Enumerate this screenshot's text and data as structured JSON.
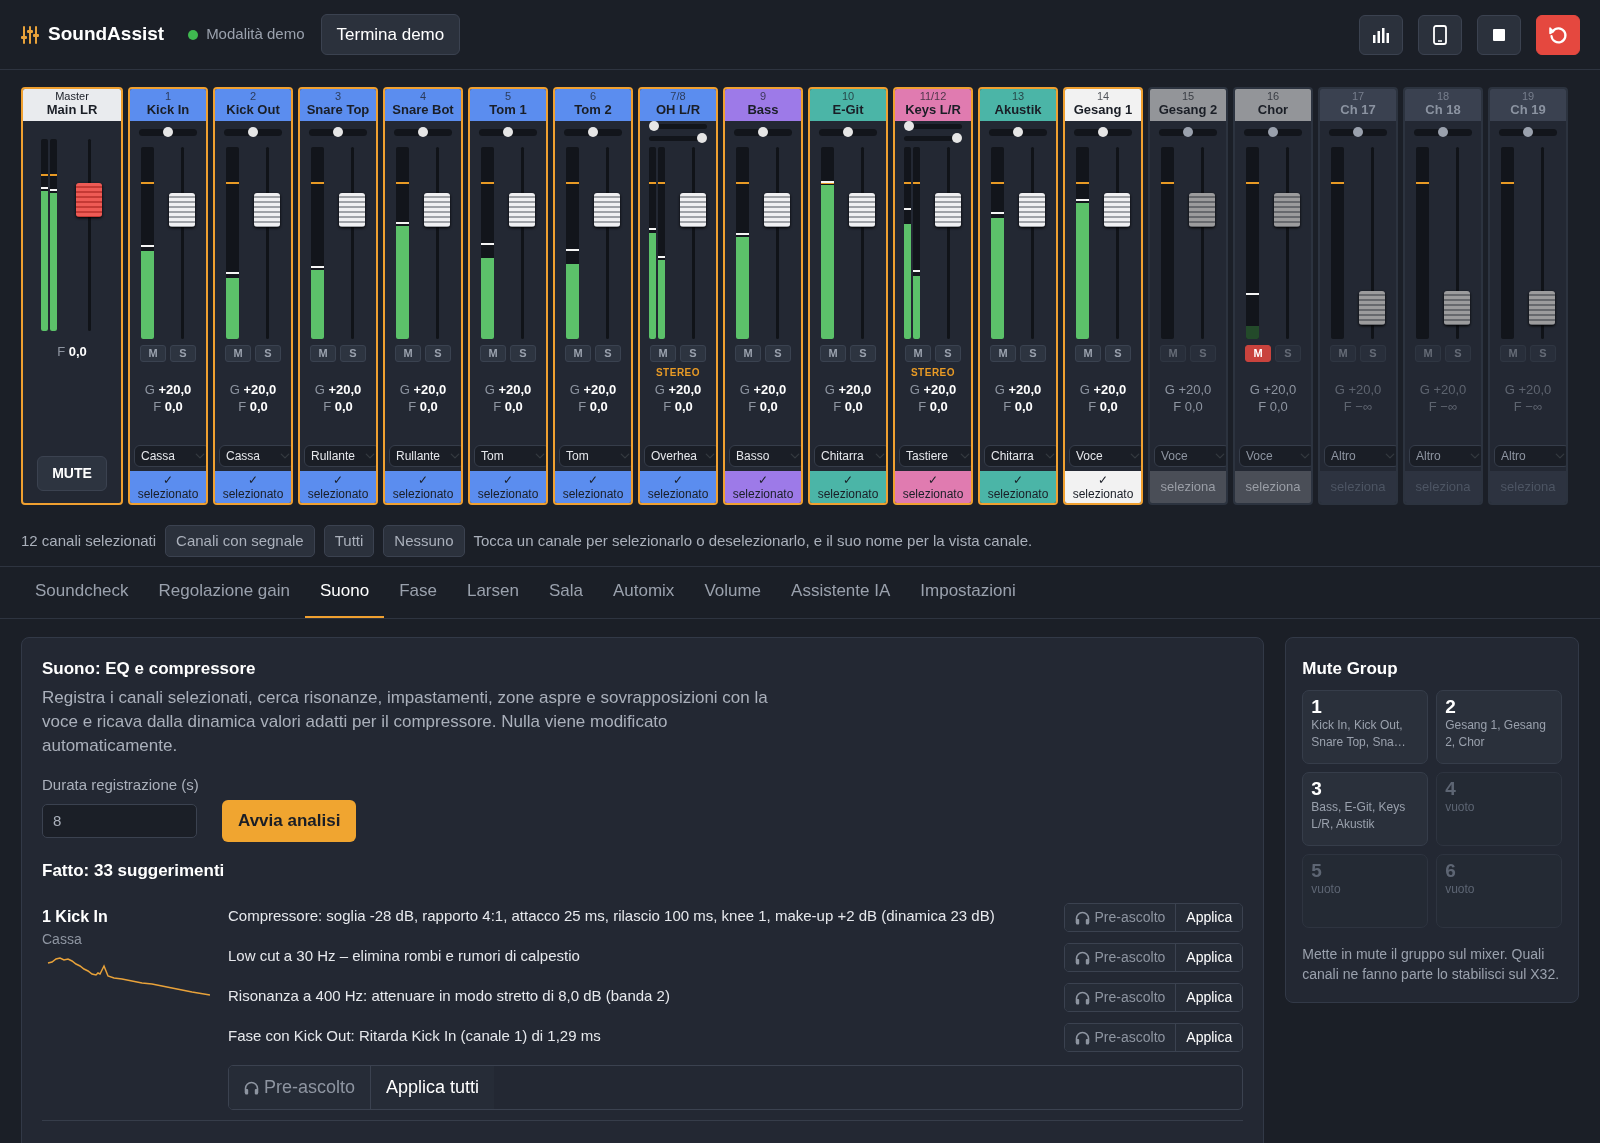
{
  "app": {
    "brand": "SoundAssist",
    "mode": {
      "label": "Modalità demo",
      "active": true
    },
    "end_demo": "Termina demo"
  },
  "master": {
    "kicker": "Master",
    "name": "Main LR",
    "meters": [
      {
        "level": 0.73,
        "peak": {
          "level": 0.74
        }
      },
      {
        "level": 0.72,
        "peak": {
          "level": 0.73
        }
      }
    ],
    "fader": {
      "label": "F",
      "value": "0,0",
      "level": 0.72
    },
    "mute_button": "MUTE"
  },
  "channels": [
    {
      "number": "1",
      "name": "Kick In",
      "color": "#5b8def",
      "selected": true,
      "pan": [
        {
          "level": 0.5
        }
      ],
      "meters": [
        {
          "level": 0.46,
          "peak": {
            "level": 0.48
          }
        }
      ],
      "mute": {
        "label": "M",
        "on": false
      },
      "solo": {
        "label": "S",
        "on": false
      },
      "gain": {
        "label": "G",
        "value": "+20,0"
      },
      "fader": {
        "label": "F",
        "value": "0,0",
        "level": 0.71
      },
      "preset": "Cassa",
      "footer": {
        "mark": "✓",
        "label": "selezionato"
      }
    },
    {
      "number": "2",
      "name": "Kick Out",
      "color": "#5b8def",
      "selected": true,
      "pan": [
        {
          "level": 0.5
        }
      ],
      "meters": [
        {
          "level": 0.32,
          "peak": {
            "level": 0.34
          }
        }
      ],
      "mute": {
        "label": "M",
        "on": false
      },
      "solo": {
        "label": "S",
        "on": false
      },
      "gain": {
        "label": "G",
        "value": "+20,0"
      },
      "fader": {
        "label": "F",
        "value": "0,0",
        "level": 0.71
      },
      "preset": "Cassa",
      "footer": {
        "mark": "✓",
        "label": "selezionato"
      }
    },
    {
      "number": "3",
      "name": "Snare Top",
      "color": "#5b8def",
      "selected": true,
      "pan": [
        {
          "level": 0.5
        }
      ],
      "meters": [
        {
          "level": 0.36,
          "peak": {
            "level": 0.37
          }
        }
      ],
      "mute": {
        "label": "M",
        "on": false
      },
      "solo": {
        "label": "S",
        "on": false
      },
      "gain": {
        "label": "G",
        "value": "+20,0"
      },
      "fader": {
        "label": "F",
        "value": "0,0",
        "level": 0.71
      },
      "preset": "Rullante",
      "footer": {
        "mark": "✓",
        "label": "selezionato"
      }
    },
    {
      "number": "4",
      "name": "Snare Bot",
      "color": "#5b8def",
      "selected": true,
      "pan": [
        {
          "level": 0.5
        }
      ],
      "meters": [
        {
          "level": 0.59,
          "peak": {
            "level": 0.6
          }
        }
      ],
      "mute": {
        "label": "M",
        "on": false
      },
      "solo": {
        "label": "S",
        "on": false
      },
      "gain": {
        "label": "G",
        "value": "+20,0"
      },
      "fader": {
        "label": "F",
        "value": "0,0",
        "level": 0.71
      },
      "preset": "Rullante",
      "footer": {
        "mark": "✓",
        "label": "selezionato"
      }
    },
    {
      "number": "5",
      "name": "Tom 1",
      "color": "#5b8def",
      "selected": true,
      "pan": [
        {
          "level": 0.5
        }
      ],
      "meters": [
        {
          "level": 0.42,
          "peak": {
            "level": 0.49
          }
        }
      ],
      "mute": {
        "label": "M",
        "on": false
      },
      "solo": {
        "label": "S",
        "on": false
      },
      "gain": {
        "label": "G",
        "value": "+20,0"
      },
      "fader": {
        "label": "F",
        "value": "0,0",
        "level": 0.71
      },
      "preset": "Tom",
      "footer": {
        "mark": "✓",
        "label": "selezionato"
      }
    },
    {
      "number": "6",
      "name": "Tom 2",
      "color": "#5b8def",
      "selected": true,
      "pan": [
        {
          "level": 0.5
        }
      ],
      "meters": [
        {
          "level": 0.39,
          "peak": {
            "level": 0.46
          }
        }
      ],
      "mute": {
        "label": "M",
        "on": false
      },
      "solo": {
        "label": "S",
        "on": false
      },
      "gain": {
        "label": "G",
        "value": "+20,0"
      },
      "fader": {
        "label": "F",
        "value": "0,0",
        "level": 0.71
      },
      "preset": "Tom",
      "footer": {
        "mark": "✓",
        "label": "selezionato"
      }
    },
    {
      "number": "7/8",
      "name": "OH L/R",
      "color": "#5b8def",
      "selected": true,
      "pan": [
        {
          "level": 0
        },
        {
          "level": 1
        }
      ],
      "meters": [
        {
          "level": 0.55,
          "peak": {
            "level": 0.57
          }
        },
        {
          "level": 0.41,
          "peak": {
            "level": 0.42
          }
        }
      ],
      "stereo": "STEREO",
      "mute": {
        "label": "M",
        "on": false
      },
      "solo": {
        "label": "S",
        "on": false
      },
      "gain": {
        "label": "G",
        "value": "+20,0"
      },
      "fader": {
        "label": "F",
        "value": "0,0",
        "level": 0.71
      },
      "preset": "Overhea",
      "footer": {
        "mark": "✓",
        "label": "selezionato"
      }
    },
    {
      "number": "9",
      "name": "Bass",
      "color": "#9d7ae8",
      "selected": true,
      "pan": [
        {
          "level": 0.5
        }
      ],
      "meters": [
        {
          "level": 0.53,
          "peak": {
            "level": 0.54
          }
        }
      ],
      "mute": {
        "label": "M",
        "on": false
      },
      "solo": {
        "label": "S",
        "on": false
      },
      "gain": {
        "label": "G",
        "value": "+20,0"
      },
      "fader": {
        "label": "F",
        "value": "0,0",
        "level": 0.71
      },
      "preset": "Basso",
      "footer": {
        "mark": "✓",
        "label": "selezionato"
      }
    },
    {
      "number": "10",
      "name": "E-Git",
      "color": "#4bb5a7",
      "selected": true,
      "pan": [
        {
          "level": 0.5
        }
      ],
      "meters": [
        {
          "level": 0.8,
          "peak": {
            "level": 0.81
          }
        }
      ],
      "mute": {
        "label": "M",
        "on": false
      },
      "solo": {
        "label": "S",
        "on": false
      },
      "gain": {
        "label": "G",
        "value": "+20,0"
      },
      "fader": {
        "label": "F",
        "value": "0,0",
        "level": 0.71
      },
      "preset": "Chitarra",
      "footer": {
        "mark": "✓",
        "label": "selezionato"
      }
    },
    {
      "number": "11/12",
      "name": "Keys L/R",
      "color": "#e07bb0",
      "selected": true,
      "pan": [
        {
          "level": 0
        },
        {
          "level": 1
        }
      ],
      "meters": [
        {
          "level": 0.6,
          "peak": {
            "level": 0.67
          }
        },
        {
          "level": 0.33,
          "peak": {
            "level": 0.35
          }
        }
      ],
      "stereo": "STEREO",
      "mute": {
        "label": "M",
        "on": false
      },
      "solo": {
        "label": "S",
        "on": false
      },
      "gain": {
        "label": "G",
        "value": "+20,0"
      },
      "fader": {
        "label": "F",
        "value": "0,0",
        "level": 0.71
      },
      "preset": "Tastiere",
      "footer": {
        "mark": "✓",
        "label": "selezionato"
      }
    },
    {
      "number": "13",
      "name": "Akustik",
      "color": "#4bb5a7",
      "selected": true,
      "pan": [
        {
          "level": 0.5
        }
      ],
      "meters": [
        {
          "level": 0.63,
          "peak": {
            "level": 0.65
          }
        }
      ],
      "mute": {
        "label": "M",
        "on": false
      },
      "solo": {
        "label": "S",
        "on": false
      },
      "gain": {
        "label": "G",
        "value": "+20,0"
      },
      "fader": {
        "label": "F",
        "value": "0,0",
        "level": 0.71
      },
      "preset": "Chitarra",
      "footer": {
        "mark": "✓",
        "label": "selezionato"
      }
    },
    {
      "number": "14",
      "name": "Gesang 1",
      "color": "#f2f2f2",
      "selected": true,
      "pan": [
        {
          "level": 0.5
        }
      ],
      "meters": [
        {
          "level": 0.71,
          "peak": {
            "level": 0.72
          }
        }
      ],
      "mute": {
        "label": "M",
        "on": false
      },
      "solo": {
        "label": "S",
        "on": false
      },
      "gain": {
        "label": "G",
        "value": "+20,0"
      },
      "fader": {
        "label": "F",
        "value": "0,0",
        "level": 0.71
      },
      "preset": "Voce",
      "footer": {
        "mark": "✓",
        "label": "selezionato"
      }
    },
    {
      "number": "15",
      "name": "Gesang 2",
      "color": "#939599",
      "selected": false,
      "pan": [
        {
          "level": 0.5
        }
      ],
      "meters": [
        {
          "level": 0
        }
      ],
      "mute": {
        "label": "M",
        "on": false
      },
      "solo": {
        "label": "S",
        "on": false
      },
      "gain": {
        "label": "G",
        "value": "+20,0"
      },
      "fader": {
        "label": "F",
        "value": "0,0",
        "level": 0.71
      },
      "preset": "Voce",
      "footer": {
        "label": "seleziona"
      }
    },
    {
      "number": "16",
      "name": "Chor",
      "color": "#939599",
      "selected": false,
      "pan": [
        {
          "level": 0.5
        }
      ],
      "meters": [
        {
          "level": 0.07,
          "peak": {
            "level": 0.23
          }
        }
      ],
      "mute": {
        "label": "M",
        "on": true
      },
      "solo": {
        "label": "S",
        "on": false
      },
      "gain": {
        "label": "G",
        "value": "+20,0"
      },
      "fader": {
        "label": "F",
        "value": "0,0",
        "level": 0.71
      },
      "preset": "Voce",
      "footer": {
        "label": "seleziona"
      }
    },
    {
      "number": "17",
      "name": "Ch 17",
      "color": "#3a4150",
      "selected": false,
      "pan": [
        {
          "level": 0.5
        }
      ],
      "meters": [
        {
          "level": 0
        }
      ],
      "mute": {
        "label": "M",
        "on": false
      },
      "solo": {
        "label": "S",
        "on": false
      },
      "gain": {
        "label": "G",
        "value": "+20,0"
      },
      "fader": {
        "label": "F",
        "value": "−∞",
        "level": 0.09
      },
      "preset": "Altro",
      "footer": {
        "label": "seleziona"
      }
    },
    {
      "number": "18",
      "name": "Ch 18",
      "color": "#3a4150",
      "selected": false,
      "pan": [
        {
          "level": 0.5
        }
      ],
      "meters": [
        {
          "level": 0
        }
      ],
      "mute": {
        "label": "M",
        "on": false
      },
      "solo": {
        "label": "S",
        "on": false
      },
      "gain": {
        "label": "G",
        "value": "+20,0"
      },
      "fader": {
        "label": "F",
        "value": "−∞",
        "level": 0.09
      },
      "preset": "Altro",
      "footer": {
        "label": "seleziona"
      }
    },
    {
      "number": "19",
      "name": "Ch 19",
      "color": "#3a4150",
      "selected": false,
      "pan": [
        {
          "level": 0.5
        }
      ],
      "meters": [
        {
          "level": 0
        }
      ],
      "mute": {
        "label": "M",
        "on": false
      },
      "solo": {
        "label": "S",
        "on": false
      },
      "gain": {
        "label": "G",
        "value": "+20,0"
      },
      "fader": {
        "label": "F",
        "value": "−∞",
        "level": 0.09
      },
      "preset": "Altro",
      "footer": {
        "label": "seleziona"
      }
    }
  ],
  "selection_bar": {
    "count": "12 canali selezionati",
    "buttons": [
      "Canali con segnale",
      "Tutti",
      "Nessuno"
    ],
    "hint": "Tocca un canale per selezionarlo o deselezionarlo, e il suo nome per la vista canale."
  },
  "tabs": [
    {
      "label": "Soundcheck",
      "selected": false
    },
    {
      "label": "Regolazione gain",
      "selected": false
    },
    {
      "label": "Suono",
      "selected": true
    },
    {
      "label": "Fase",
      "selected": false
    },
    {
      "label": "Larsen",
      "selected": false
    },
    {
      "label": "Sala",
      "selected": false
    },
    {
      "label": "Automix",
      "selected": false
    },
    {
      "label": "Volume",
      "selected": false
    },
    {
      "label": "Assistente IA",
      "selected": false
    },
    {
      "label": "Impostazioni",
      "selected": false
    }
  ],
  "sound_panel": {
    "title": "Suono: EQ e compressore",
    "description": "Registra i canali selezionati, cerca risonanze, impastamenti, zone aspre e sovrapposizioni con la voce e ricava dalla dinamica valori adatti per il compressore. Nulla viene modificato automaticamente.",
    "duration_label": "Durata registrazione (s)",
    "duration_value": "8",
    "analyze_button": "Avvia analisi",
    "result_title": "Fatto: 33 suggerimenti",
    "results": [
      {
        "channel": "1 Kick In",
        "category": "Cassa",
        "suggestions": [
          {
            "text": "Compressore: soglia -28 dB, rapporto 4:1, attacco 25 ms, rilascio 100 ms, knee 1, make-up +2 dB (dinamica 23 dB)",
            "preview": "Pre-ascolto",
            "apply": "Applica"
          },
          {
            "text": "Low cut a 30 Hz – elimina rombi e rumori di calpestio",
            "preview": "Pre-ascolto",
            "apply": "Applica"
          },
          {
            "text": "Risonanza a 400 Hz: attenuare in modo stretto di 8,0 dB (banda 2)",
            "preview": "Pre-ascolto",
            "apply": "Applica"
          },
          {
            "text": "Fase con Kick Out: Ritarda Kick In (canale 1) di 1,29 ms",
            "preview": "Pre-ascolto",
            "apply": "Applica"
          }
        ],
        "preview_all": "Pre-ascolto",
        "apply_all": "Applica tutti"
      }
    ]
  },
  "mute_groups": {
    "title": "Mute Group",
    "groups": [
      {
        "number": "1",
        "members": "Kick In, Kick Out, Snare Top, Sna…",
        "empty": false
      },
      {
        "number": "2",
        "members": "Gesang 1, Gesang 2, Chor",
        "empty": false
      },
      {
        "number": "3",
        "members": "Bass, E-Git, Keys L/R, Akustik",
        "empty": false
      },
      {
        "number": "4",
        "members": "vuoto",
        "empty": true
      },
      {
        "number": "5",
        "members": "vuoto",
        "empty": true
      },
      {
        "number": "6",
        "members": "vuoto",
        "empty": true
      }
    ],
    "note": "Mette in mute il gruppo sul mixer. Quali canali ne fanno parte lo stabilisci sul X32."
  }
}
